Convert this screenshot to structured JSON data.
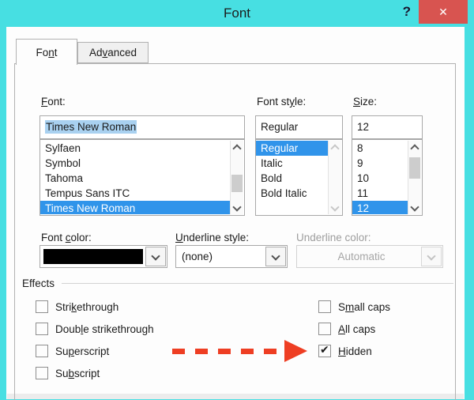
{
  "window": {
    "title": "Font",
    "help_icon": "?",
    "close_icon": "✕",
    "checkmark_icon": "✔"
  },
  "colors": {
    "titlebar_teal": "#47dfe2",
    "close_button_red": "#d85450",
    "list_selection_blue": "#3094ea",
    "input_selection_blue": "#a9d1f0",
    "arrow_red": "#ee3e23",
    "font_color_swatch": "#000000"
  },
  "tabs": [
    {
      "text": "Font",
      "accel": 2,
      "active": true
    },
    {
      "text": "Advanced",
      "accel": 2,
      "active": false
    }
  ],
  "font_section": {
    "label": {
      "text": "Font:",
      "accel": 0
    },
    "value": "Times New Roman",
    "items": [
      "Sylfaen",
      "Symbol",
      "Tahoma",
      "Tempus Sans ITC",
      "Times New Roman"
    ],
    "selected": "Times New Roman"
  },
  "style_section": {
    "label": {
      "text": "Font style:",
      "accel": 7
    },
    "value": "Regular",
    "items": [
      "Regular",
      "Italic",
      "Bold",
      "Bold Italic"
    ],
    "selected": "Regular"
  },
  "size_section": {
    "label": {
      "text": "Size:",
      "accel": 0
    },
    "value": "12",
    "items": [
      "8",
      "9",
      "10",
      "11",
      "12"
    ],
    "selected": "12"
  },
  "font_color": {
    "label": {
      "text": "Font color:",
      "accel": 5
    }
  },
  "underline_style": {
    "label": {
      "text": "Underline style:",
      "accel": 0
    },
    "value": "(none)"
  },
  "underline_color": {
    "label": {
      "text": "Underline color:",
      "accel": -1
    },
    "value": "Automatic",
    "disabled": true
  },
  "effects": {
    "label": "Effects",
    "left": [
      {
        "text": "Strikethrough",
        "accel": 4,
        "checked": false
      },
      {
        "text": "Double strikethrough",
        "accel": 4,
        "checked": false
      },
      {
        "text": "Superscript",
        "accel": 2,
        "checked": false
      },
      {
        "text": "Subscript",
        "accel": 2,
        "checked": false
      }
    ],
    "right": [
      {
        "text": "Small caps",
        "accel": 1,
        "checked": false
      },
      {
        "text": "All caps",
        "accel": 0,
        "checked": false
      },
      {
        "text": "Hidden",
        "accel": 0,
        "checked": true
      }
    ]
  }
}
